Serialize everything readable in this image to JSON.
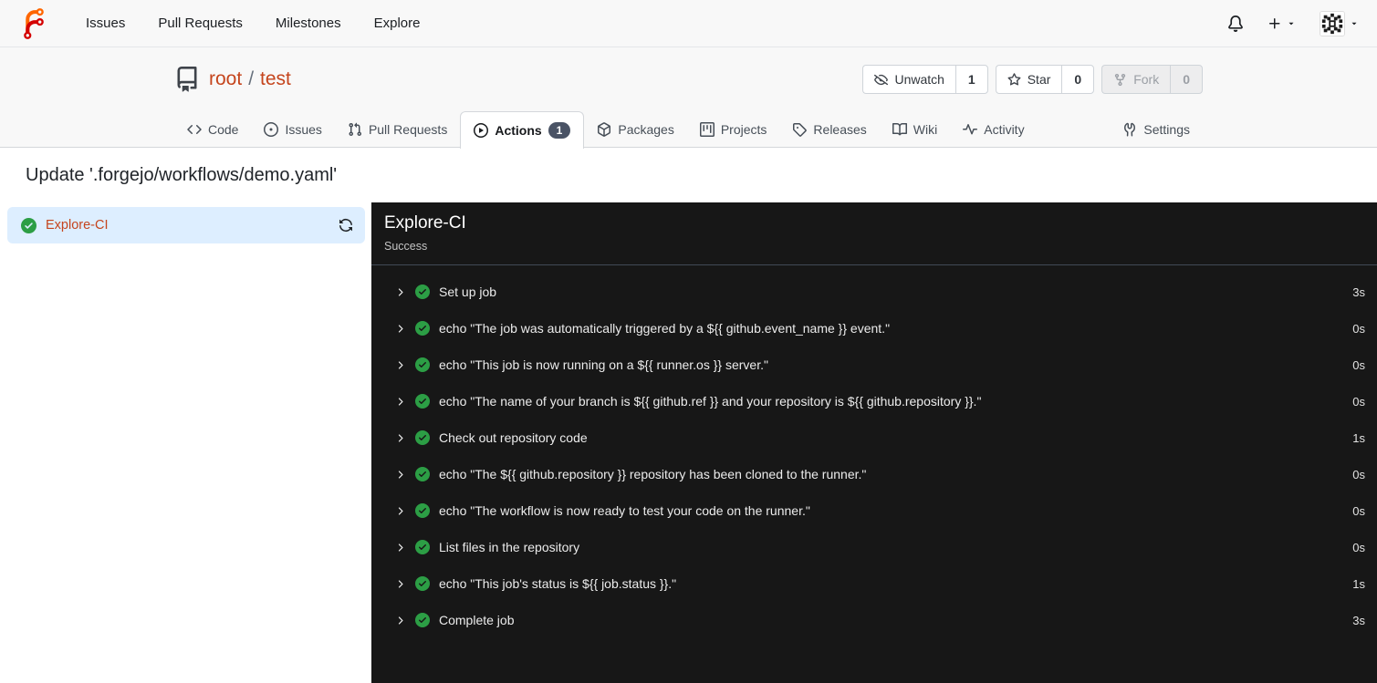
{
  "navbar": {
    "links": [
      {
        "label": "Issues"
      },
      {
        "label": "Pull Requests"
      },
      {
        "label": "Milestones"
      },
      {
        "label": "Explore"
      }
    ]
  },
  "repo": {
    "owner": "root",
    "separator": "/",
    "name": "test",
    "actions": [
      {
        "label": "Unwatch",
        "count": "1",
        "disabled": false
      },
      {
        "label": "Star",
        "count": "0",
        "disabled": false
      },
      {
        "label": "Fork",
        "count": "0",
        "disabled": true
      }
    ]
  },
  "tabs": [
    {
      "label": "Code"
    },
    {
      "label": "Issues"
    },
    {
      "label": "Pull Requests"
    },
    {
      "label": "Actions",
      "badge": "1",
      "active": true
    },
    {
      "label": "Packages"
    },
    {
      "label": "Projects"
    },
    {
      "label": "Releases"
    },
    {
      "label": "Wiki"
    },
    {
      "label": "Activity"
    },
    {
      "label": "Settings"
    }
  ],
  "run": {
    "commit_title": "Update '.forgejo/workflows/demo.yaml'",
    "job": {
      "name": "Explore-CI",
      "status_icon": "success-check"
    },
    "console": {
      "title": "Explore-CI",
      "status": "Success"
    },
    "steps": [
      {
        "name": "Set up job",
        "duration": "3s"
      },
      {
        "name": "echo \"The job was automatically triggered by a ${{ github.event_name }} event.\"",
        "duration": "0s"
      },
      {
        "name": "echo \"This job is now running on a ${{ runner.os }} server.\"",
        "duration": "0s"
      },
      {
        "name": "echo \"The name of your branch is ${{ github.ref }} and your repository is ${{ github.repository }}.\"",
        "duration": "0s"
      },
      {
        "name": "Check out repository code",
        "duration": "1s"
      },
      {
        "name": "echo \"The ${{ github.repository }} repository has been cloned to the runner.\"",
        "duration": "0s"
      },
      {
        "name": "echo \"The workflow is now ready to test your code on the runner.\"",
        "duration": "0s"
      },
      {
        "name": "List files in the repository",
        "duration": "0s"
      },
      {
        "name": "echo \"This job's status is ${{ job.status }}.\"",
        "duration": "1s"
      },
      {
        "name": "Complete job",
        "duration": "3s"
      }
    ]
  },
  "colors": {
    "accent_link": "#c5451d",
    "header_bg": "#f8f8f8",
    "console_bg": "#171717",
    "success_green": "#2c9e45",
    "selected_job_bg": "#ddeeff",
    "badge_bg": "#4a5365"
  }
}
